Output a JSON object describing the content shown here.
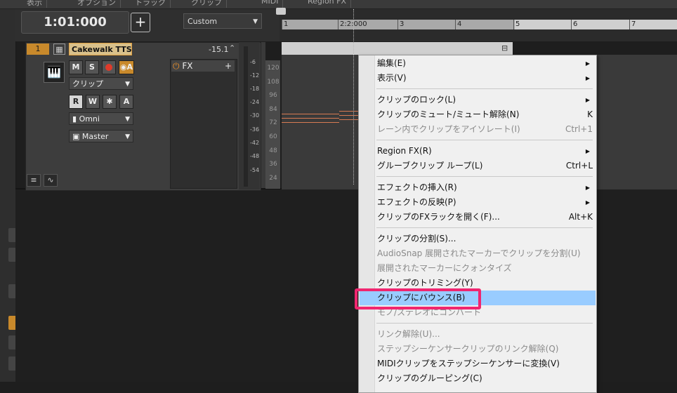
{
  "menubar": {
    "tabs": [
      "表示",
      "オプション",
      "トラック",
      "クリップ",
      "MIDI",
      "Region FX"
    ]
  },
  "transport": {
    "time": "1:01:000",
    "add_label": "+",
    "preset": "Custom"
  },
  "ruler": {
    "marks": [
      "1",
      "2:2:000",
      "3",
      "4",
      "5",
      "6",
      "7"
    ]
  },
  "track": {
    "number": "1",
    "name": "Cakewalk TTS-",
    "volume": "-15.1",
    "buttons": {
      "mute": "M",
      "solo": "S",
      "read": "R",
      "write": "W",
      "input_echo_star": "✱",
      "auto": "A"
    },
    "clip_select": "クリップ",
    "input": "Omni",
    "output": "Master",
    "fx_label": "FX",
    "fx_add": "+"
  },
  "meter": {
    "scale": [
      "-6",
      "-12",
      "-18",
      "-24",
      "-30",
      "-36",
      "-42",
      "-48",
      "-54"
    ]
  },
  "velocity_scale": [
    "120",
    "108",
    "96",
    "84",
    "72",
    "60",
    "48",
    "36",
    "24"
  ],
  "context_menu": {
    "items": [
      {
        "label": "編集(E)",
        "shortcut": "",
        "submenu": true,
        "disabled": false
      },
      {
        "label": "表示(V)",
        "shortcut": "",
        "submenu": true,
        "disabled": false
      },
      {
        "sep": true
      },
      {
        "label": "クリップのロック(L)",
        "shortcut": "",
        "submenu": true,
        "disabled": false
      },
      {
        "label": "クリップのミュート/ミュート解除(N)",
        "shortcut": "K",
        "submenu": false,
        "disabled": false
      },
      {
        "label": "レーン内でクリップをアイソレート(I)",
        "shortcut": "Ctrl+1",
        "submenu": false,
        "disabled": true
      },
      {
        "sep": true
      },
      {
        "label": "Region FX(R)",
        "shortcut": "",
        "submenu": true,
        "disabled": false
      },
      {
        "label": "グルーブクリップ ループ(L)",
        "shortcut": "Ctrl+L",
        "submenu": false,
        "disabled": false
      },
      {
        "sep": true
      },
      {
        "label": "エフェクトの挿入(R)",
        "shortcut": "",
        "submenu": true,
        "disabled": false
      },
      {
        "label": "エフェクトの反映(P)",
        "shortcut": "",
        "submenu": true,
        "disabled": false
      },
      {
        "label": "クリップのFXラックを開く(F)...",
        "shortcut": "Alt+K",
        "submenu": false,
        "disabled": false
      },
      {
        "sep": true
      },
      {
        "label": "クリップの分割(S)...",
        "shortcut": "",
        "submenu": false,
        "disabled": false
      },
      {
        "label": "AudioSnap 展開されたマーカーでクリップを分割(U)",
        "shortcut": "",
        "submenu": false,
        "disabled": true
      },
      {
        "label": "展開されたマーカーにクォンタイズ",
        "shortcut": "",
        "submenu": false,
        "disabled": true
      },
      {
        "label": "クリップのトリミング(Y)",
        "shortcut": "",
        "submenu": false,
        "disabled": false
      },
      {
        "label": "クリップにバウンス(B)",
        "shortcut": "",
        "submenu": false,
        "disabled": false,
        "highlighted": true
      },
      {
        "label": "モノ/ステレオにコンバート",
        "shortcut": "",
        "submenu": false,
        "disabled": true
      },
      {
        "sep": true
      },
      {
        "label": "リンク解除(U)...",
        "shortcut": "",
        "submenu": false,
        "disabled": true
      },
      {
        "label": "ステップシーケンサークリップのリンク解除(Q)",
        "shortcut": "",
        "submenu": false,
        "disabled": true
      },
      {
        "label": "MIDIクリップをステップシーケンサーに変換(V)",
        "shortcut": "",
        "submenu": false,
        "disabled": false
      },
      {
        "label": "クリップのグルーピング(C)",
        "shortcut": "",
        "submenu": false,
        "disabled": false
      }
    ]
  },
  "colors": {
    "highlight": "#99ccff",
    "annotation_box": "#f0266f",
    "track_number": "#c8892b",
    "notes": "#d77a52"
  }
}
